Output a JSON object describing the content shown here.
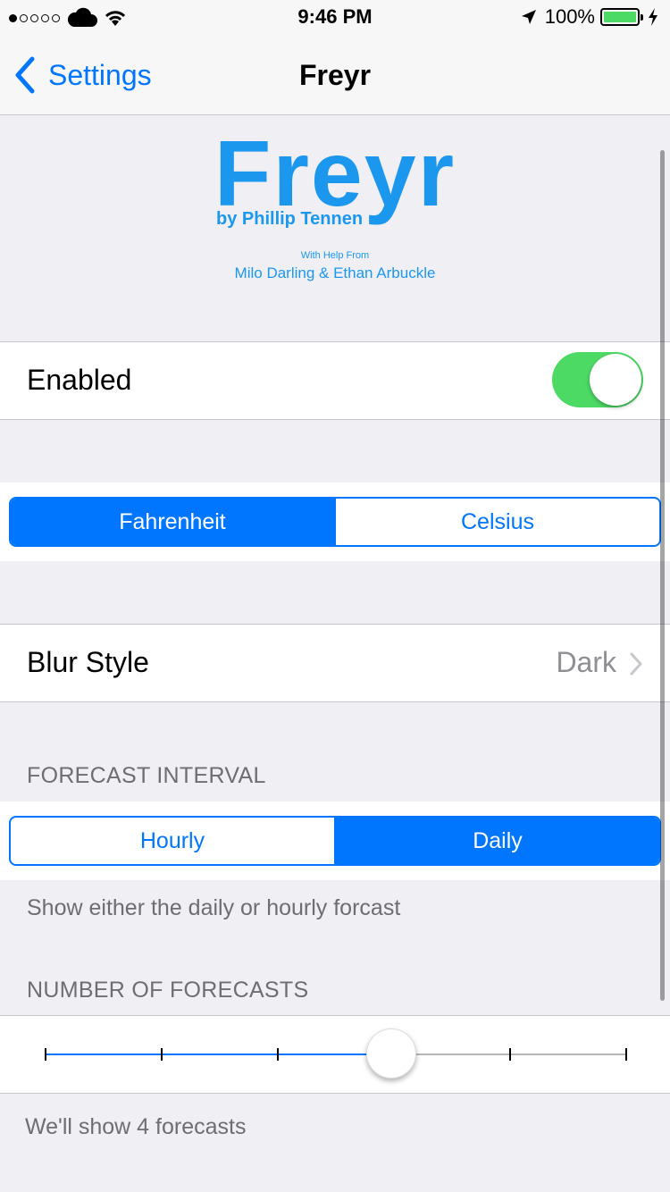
{
  "status_bar": {
    "time": "9:46 PM",
    "battery": "100%",
    "signal_bars_filled": 1,
    "signal_bars_total": 5
  },
  "nav": {
    "back_label": "Settings",
    "title": "Freyr"
  },
  "header": {
    "logo_title": "Freyr",
    "byline": "by Phillip Tennen",
    "help_label": "With Help From",
    "help_names": "Milo Darling & Ethan Arbuckle"
  },
  "enabled": {
    "label": "Enabled",
    "value": true
  },
  "units": {
    "options": [
      "Fahrenheit",
      "Celsius"
    ],
    "selected": "Fahrenheit"
  },
  "blur_style": {
    "label": "Blur Style",
    "value": "Dark"
  },
  "forecast_interval": {
    "header": "FORECAST INTERVAL",
    "options": [
      "Hourly",
      "Daily"
    ],
    "selected": "Daily",
    "footer": "Show either the daily or hourly forcast"
  },
  "number_of_forecasts": {
    "header": "NUMBER OF FORECASTS",
    "ticks": 6,
    "value_fraction": 0.6,
    "footer": "We'll show 4 forecasts"
  },
  "colors": {
    "accent": "#0076ff",
    "toggle_on": "#4cd964",
    "logo": "#1c97ee",
    "background": "#efeff4"
  }
}
